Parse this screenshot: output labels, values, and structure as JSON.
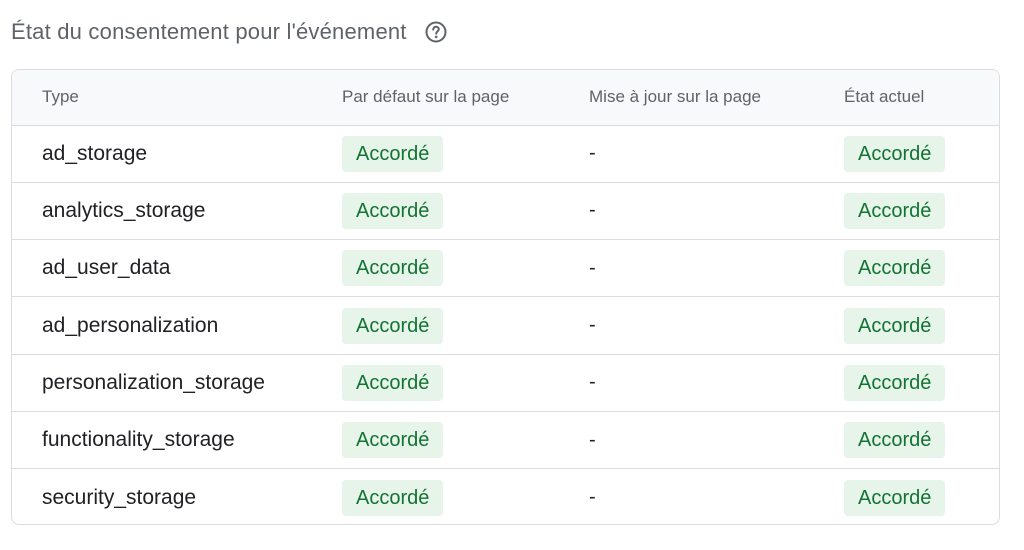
{
  "header": {
    "title": "État du consentement pour l'événement",
    "help_icon": "help-circle-icon"
  },
  "table": {
    "columns": [
      "Type",
      "Par défaut sur la page",
      "Mise à jour sur la page",
      "État actuel"
    ],
    "rows": [
      {
        "type": "ad_storage",
        "default": "Accordé",
        "update": "-",
        "current": "Accordé"
      },
      {
        "type": "analytics_storage",
        "default": "Accordé",
        "update": "-",
        "current": "Accordé"
      },
      {
        "type": "ad_user_data",
        "default": "Accordé",
        "update": "-",
        "current": "Accordé"
      },
      {
        "type": "ad_personalization",
        "default": "Accordé",
        "update": "-",
        "current": "Accordé"
      },
      {
        "type": "personalization_storage",
        "default": "Accordé",
        "update": "-",
        "current": "Accordé"
      },
      {
        "type": "functionality_storage",
        "default": "Accordé",
        "update": "-",
        "current": "Accordé"
      },
      {
        "type": "security_storage",
        "default": "Accordé",
        "update": "-",
        "current": "Accordé"
      }
    ]
  },
  "colors": {
    "chip_bg": "#e6f4ea",
    "chip_text": "#137333",
    "border": "#dadce0",
    "header_bg": "#f8f9fa"
  }
}
